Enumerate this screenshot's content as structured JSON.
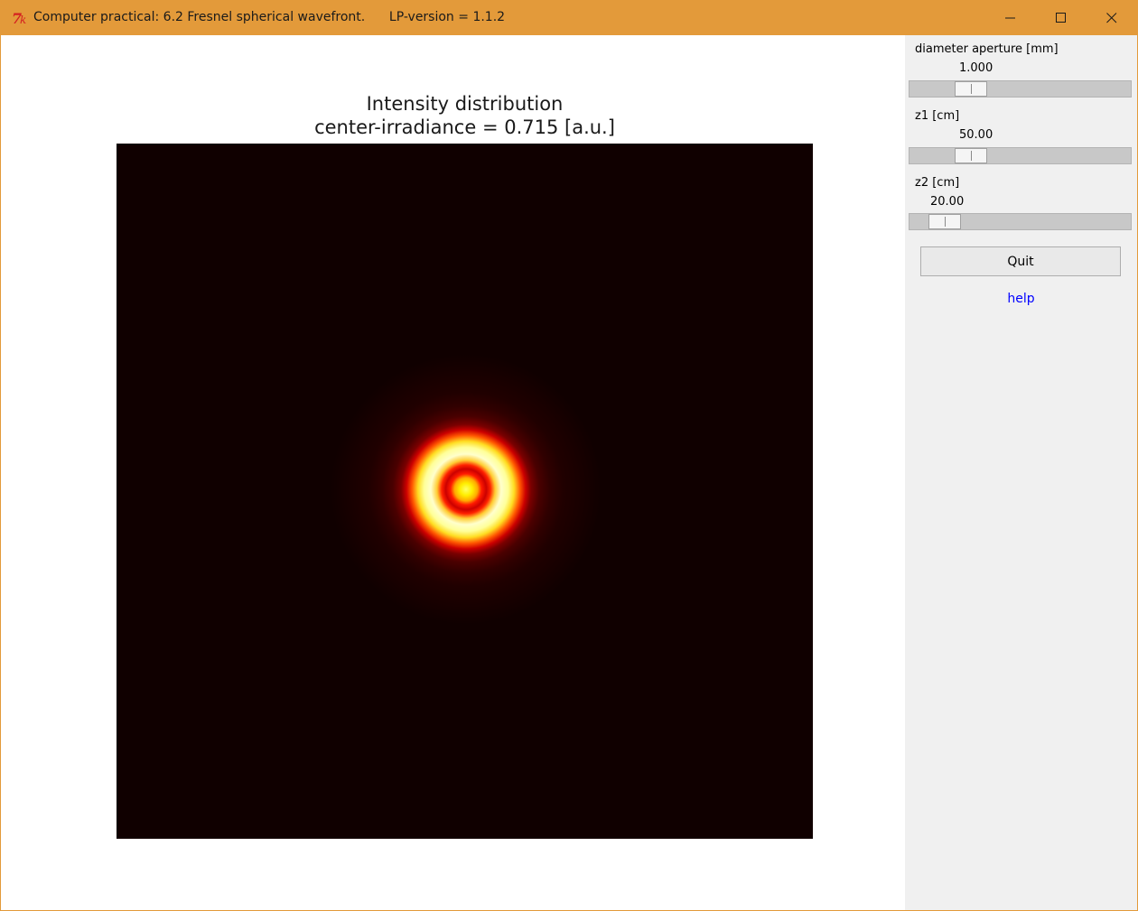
{
  "window": {
    "title": "Computer practical: 6.2 Fresnel spherical wavefront.      LP-version = 1.1.2",
    "titlebar_color": "#e39a3a",
    "logo_icon": "tk-feather-icon",
    "controls": {
      "minimize_icon": "minimize-icon",
      "maximize_icon": "maximize-icon",
      "close_icon": "close-icon"
    }
  },
  "plot": {
    "title_line1": "Intensity distribution",
    "title_line2": "center-irradiance = 0.715 [a.u.]",
    "colormap": "hot",
    "background_color": "#100000"
  },
  "chart_data": {
    "type": "heatmap",
    "title": "Intensity distribution\ncenter-irradiance = 0.715 [a.u.]",
    "colormap": "hot",
    "pattern": "concentric Fresnel diffraction rings, centered",
    "rings": [
      {
        "radius": 0.0,
        "intensity": 0.8
      },
      {
        "radius": 0.012,
        "intensity": 1.0
      },
      {
        "radius": 0.03,
        "intensity": 0.55
      },
      {
        "radius": 0.05,
        "intensity": 0.4
      },
      {
        "radius": 0.085,
        "intensity": 0.95
      },
      {
        "radius": 0.105,
        "intensity": 1.0
      },
      {
        "radius": 0.125,
        "intensity": 0.55
      },
      {
        "radius": 0.16,
        "intensity": 0.15
      },
      {
        "radius": 0.185,
        "intensity": 0.06
      },
      {
        "radius": 0.22,
        "intensity": 0.0
      }
    ]
  },
  "controls": {
    "diameter": {
      "label": "diameter aperture [mm]",
      "value": "1.000",
      "fraction": 0.24
    },
    "z1": {
      "label": "z1 [cm]",
      "value": "50.00",
      "fraction": 0.24
    },
    "z2": {
      "label": "z2 [cm]",
      "value": "20.00",
      "fraction": 0.1
    },
    "quit_label": "Quit",
    "help_label": "help",
    "help_color": "#0000ff"
  }
}
